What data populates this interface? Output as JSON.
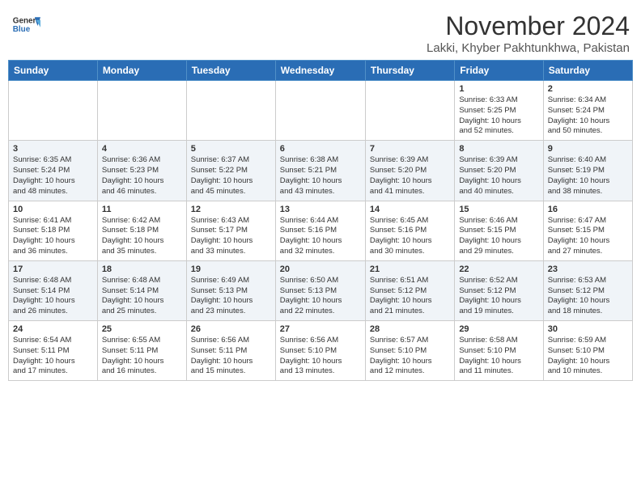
{
  "header": {
    "logo_line1": "General",
    "logo_line2": "Blue",
    "month": "November 2024",
    "location": "Lakki, Khyber Pakhtunkhwa, Pakistan"
  },
  "weekdays": [
    "Sunday",
    "Monday",
    "Tuesday",
    "Wednesday",
    "Thursday",
    "Friday",
    "Saturday"
  ],
  "weeks": [
    [
      {
        "day": "",
        "info": ""
      },
      {
        "day": "",
        "info": ""
      },
      {
        "day": "",
        "info": ""
      },
      {
        "day": "",
        "info": ""
      },
      {
        "day": "",
        "info": ""
      },
      {
        "day": "1",
        "info": "Sunrise: 6:33 AM\nSunset: 5:25 PM\nDaylight: 10 hours\nand 52 minutes."
      },
      {
        "day": "2",
        "info": "Sunrise: 6:34 AM\nSunset: 5:24 PM\nDaylight: 10 hours\nand 50 minutes."
      }
    ],
    [
      {
        "day": "3",
        "info": "Sunrise: 6:35 AM\nSunset: 5:24 PM\nDaylight: 10 hours\nand 48 minutes."
      },
      {
        "day": "4",
        "info": "Sunrise: 6:36 AM\nSunset: 5:23 PM\nDaylight: 10 hours\nand 46 minutes."
      },
      {
        "day": "5",
        "info": "Sunrise: 6:37 AM\nSunset: 5:22 PM\nDaylight: 10 hours\nand 45 minutes."
      },
      {
        "day": "6",
        "info": "Sunrise: 6:38 AM\nSunset: 5:21 PM\nDaylight: 10 hours\nand 43 minutes."
      },
      {
        "day": "7",
        "info": "Sunrise: 6:39 AM\nSunset: 5:20 PM\nDaylight: 10 hours\nand 41 minutes."
      },
      {
        "day": "8",
        "info": "Sunrise: 6:39 AM\nSunset: 5:20 PM\nDaylight: 10 hours\nand 40 minutes."
      },
      {
        "day": "9",
        "info": "Sunrise: 6:40 AM\nSunset: 5:19 PM\nDaylight: 10 hours\nand 38 minutes."
      }
    ],
    [
      {
        "day": "10",
        "info": "Sunrise: 6:41 AM\nSunset: 5:18 PM\nDaylight: 10 hours\nand 36 minutes."
      },
      {
        "day": "11",
        "info": "Sunrise: 6:42 AM\nSunset: 5:18 PM\nDaylight: 10 hours\nand 35 minutes."
      },
      {
        "day": "12",
        "info": "Sunrise: 6:43 AM\nSunset: 5:17 PM\nDaylight: 10 hours\nand 33 minutes."
      },
      {
        "day": "13",
        "info": "Sunrise: 6:44 AM\nSunset: 5:16 PM\nDaylight: 10 hours\nand 32 minutes."
      },
      {
        "day": "14",
        "info": "Sunrise: 6:45 AM\nSunset: 5:16 PM\nDaylight: 10 hours\nand 30 minutes."
      },
      {
        "day": "15",
        "info": "Sunrise: 6:46 AM\nSunset: 5:15 PM\nDaylight: 10 hours\nand 29 minutes."
      },
      {
        "day": "16",
        "info": "Sunrise: 6:47 AM\nSunset: 5:15 PM\nDaylight: 10 hours\nand 27 minutes."
      }
    ],
    [
      {
        "day": "17",
        "info": "Sunrise: 6:48 AM\nSunset: 5:14 PM\nDaylight: 10 hours\nand 26 minutes."
      },
      {
        "day": "18",
        "info": "Sunrise: 6:48 AM\nSunset: 5:14 PM\nDaylight: 10 hours\nand 25 minutes."
      },
      {
        "day": "19",
        "info": "Sunrise: 6:49 AM\nSunset: 5:13 PM\nDaylight: 10 hours\nand 23 minutes."
      },
      {
        "day": "20",
        "info": "Sunrise: 6:50 AM\nSunset: 5:13 PM\nDaylight: 10 hours\nand 22 minutes."
      },
      {
        "day": "21",
        "info": "Sunrise: 6:51 AM\nSunset: 5:12 PM\nDaylight: 10 hours\nand 21 minutes."
      },
      {
        "day": "22",
        "info": "Sunrise: 6:52 AM\nSunset: 5:12 PM\nDaylight: 10 hours\nand 19 minutes."
      },
      {
        "day": "23",
        "info": "Sunrise: 6:53 AM\nSunset: 5:12 PM\nDaylight: 10 hours\nand 18 minutes."
      }
    ],
    [
      {
        "day": "24",
        "info": "Sunrise: 6:54 AM\nSunset: 5:11 PM\nDaylight: 10 hours\nand 17 minutes."
      },
      {
        "day": "25",
        "info": "Sunrise: 6:55 AM\nSunset: 5:11 PM\nDaylight: 10 hours\nand 16 minutes."
      },
      {
        "day": "26",
        "info": "Sunrise: 6:56 AM\nSunset: 5:11 PM\nDaylight: 10 hours\nand 15 minutes."
      },
      {
        "day": "27",
        "info": "Sunrise: 6:56 AM\nSunset: 5:10 PM\nDaylight: 10 hours\nand 13 minutes."
      },
      {
        "day": "28",
        "info": "Sunrise: 6:57 AM\nSunset: 5:10 PM\nDaylight: 10 hours\nand 12 minutes."
      },
      {
        "day": "29",
        "info": "Sunrise: 6:58 AM\nSunset: 5:10 PM\nDaylight: 10 hours\nand 11 minutes."
      },
      {
        "day": "30",
        "info": "Sunrise: 6:59 AM\nSunset: 5:10 PM\nDaylight: 10 hours\nand 10 minutes."
      }
    ]
  ]
}
